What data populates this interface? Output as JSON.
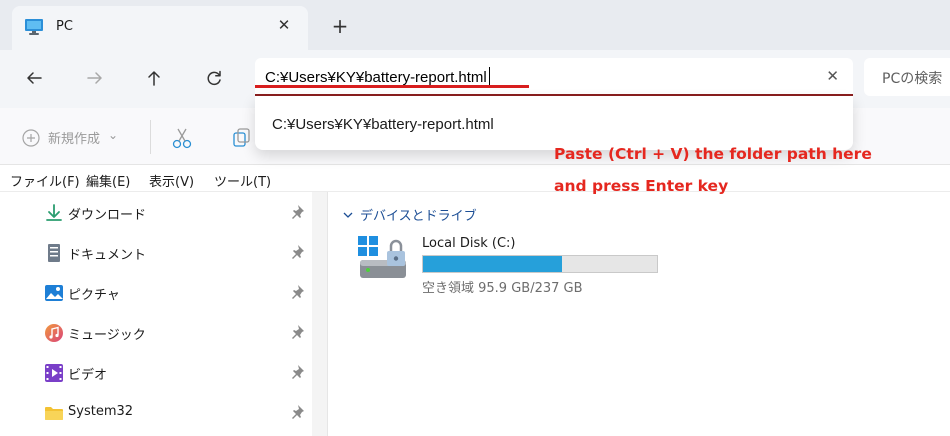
{
  "tab": {
    "title": "PC",
    "close_glyph": "✕",
    "new_tab_glyph": "+"
  },
  "address_bar": {
    "value": "C:¥Users¥KY¥battery-report.html",
    "clear_glyph": "✕",
    "suggestion": "C:¥Users¥KY¥battery-report.html"
  },
  "search": {
    "placeholder": "PCの検索"
  },
  "command_bar": {
    "new_label": "新規作成",
    "new_chevron": "⌄"
  },
  "annotation": {
    "line1": "Paste (Ctrl + V) the folder path here",
    "line2": "and press Enter key",
    "color": "#e5271f"
  },
  "menu": [
    {
      "label": "ファイル(F)"
    },
    {
      "label": "編集(E)"
    },
    {
      "label": "表示(V)"
    },
    {
      "label": "ツール(T)"
    }
  ],
  "sidebar": {
    "items": [
      {
        "label": "ダウンロード",
        "icon": "download-icon"
      },
      {
        "label": "ドキュメント",
        "icon": "document-icon"
      },
      {
        "label": "ピクチャ",
        "icon": "pictures-icon"
      },
      {
        "label": "ミュージック",
        "icon": "music-icon"
      },
      {
        "label": "ビデオ",
        "icon": "video-icon"
      },
      {
        "label": "System32",
        "icon": "folder-icon"
      }
    ]
  },
  "devices": {
    "header": "デバイスとドライブ",
    "drive": {
      "name": "Local Disk (C:)",
      "free_text": "空き領域 95.9 GB/237 GB",
      "used_fraction": 0.595,
      "bar_color": "#26a0da"
    }
  }
}
